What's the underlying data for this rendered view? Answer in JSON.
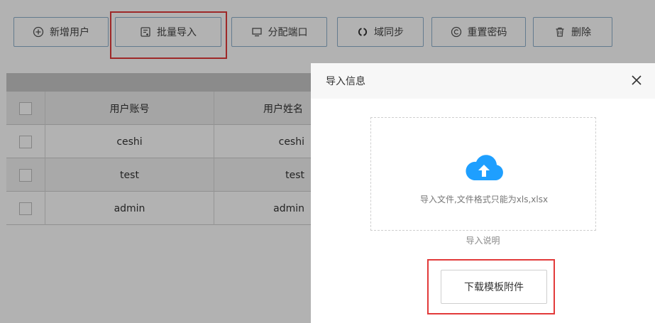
{
  "toolbar": {
    "buttons": [
      {
        "label": "新增用户",
        "icon": "plus-circle-icon"
      },
      {
        "label": "批量导入",
        "icon": "import-list-icon"
      },
      {
        "label": "分配端口",
        "icon": "monitor-icon"
      },
      {
        "label": "域同步",
        "icon": "sync-icon"
      },
      {
        "label": "重置密码",
        "icon": "reset-c-icon"
      },
      {
        "label": "删除",
        "icon": "trash-icon"
      }
    ]
  },
  "table": {
    "headers": [
      "用户账号",
      "用户姓名"
    ],
    "rows": [
      {
        "account": "ceshi",
        "name": "ceshi"
      },
      {
        "account": "test",
        "name": "test"
      },
      {
        "account": "admin",
        "name": "admin"
      }
    ]
  },
  "modal": {
    "title": "导入信息",
    "close_icon": "close-icon",
    "upload_icon": "cloud-upload-icon",
    "upload_tip": "导入文件,文件格式只能为xls,xlsx",
    "guide": "导入说明",
    "download_label": "下载模板附件"
  },
  "colors": {
    "highlight": "#e23a3a",
    "accent": "#1e9fff",
    "border": "#8fb0cc"
  }
}
